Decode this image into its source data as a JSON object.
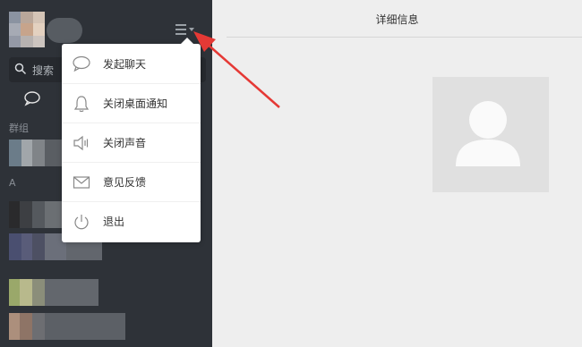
{
  "search": {
    "placeholder": "搜索"
  },
  "sidebar": {
    "section_groups": "群组",
    "section_a": "A"
  },
  "main": {
    "title": "详细信息"
  },
  "dropdown": {
    "items": [
      {
        "label": "发起聊天",
        "icon": "chat-bubble-icon"
      },
      {
        "label": "关闭桌面通知",
        "icon": "bell-icon"
      },
      {
        "label": "关闭声音",
        "icon": "speaker-icon"
      },
      {
        "label": "意见反馈",
        "icon": "envelope-icon"
      },
      {
        "label": "退出",
        "icon": "power-icon"
      }
    ]
  },
  "colors": {
    "sidebar_bg": "#2e3238",
    "main_bg": "#eeeeee",
    "arrow": "#e53935"
  }
}
